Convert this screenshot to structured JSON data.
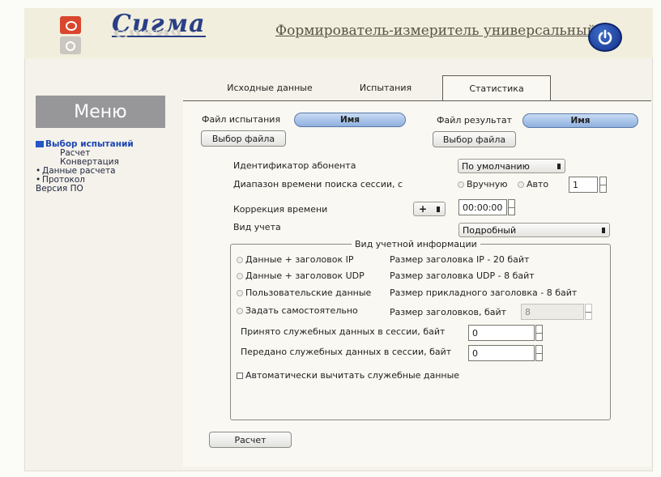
{
  "header": {
    "brand": "Сигма",
    "brand_reflection": "Сигма",
    "app_title": "Формирователь-измеритель универсальный"
  },
  "sidebar": {
    "title": "Меню",
    "items": [
      {
        "label": "Выбор испытаний",
        "level": 0,
        "active": true
      },
      {
        "label": "Расчет",
        "level": 1
      },
      {
        "label": "Конвертация",
        "level": 1
      },
      {
        "label": "Данные расчета",
        "level": 0,
        "bullet": "•"
      },
      {
        "label": "Протокол",
        "level": 0,
        "bullet": "•"
      },
      {
        "label": "Версия ПО",
        "level": 0
      }
    ]
  },
  "tabs": [
    {
      "label": "Исходные данные"
    },
    {
      "label": "Испытания"
    },
    {
      "label": "Статистика",
      "active": true
    }
  ],
  "files": {
    "test_label": "Файл испытания",
    "test_name": "Имя",
    "result_label": "Файл результат",
    "result_name": "Имя",
    "choose_button": "Выбор файла"
  },
  "form": {
    "subscriber_id_label": "Идентификатор абонента",
    "subscriber_id_value": "По умолчанию",
    "range_label": "Диапазон времени поиска сессии, с",
    "manual_label": "Вручную",
    "auto_label": "Авто",
    "range_value": "1",
    "correction_label": "Коррекция времени",
    "correction_sign": "+",
    "correction_value": "00:00:00",
    "accounting_label": "Вид учета",
    "accounting_value": "Подробный"
  },
  "group": {
    "title": "Вид учетной информации",
    "options": [
      {
        "label": "Данные + заголовок IP",
        "info": "Размер заголовка IP - 20 байт"
      },
      {
        "label": "Данные + заголовок UDP",
        "info": "Размер заголовка UDP - 8 байт"
      },
      {
        "label": "Пользовательские данные",
        "info": "Размер прикладного заголовка - 8 байт"
      },
      {
        "label": "Задать самостоятельно",
        "info": "Размер заголовков, байт"
      }
    ],
    "header_size_value": "8",
    "received_label": "Принято служебных данных в сессии, байт",
    "received_value": "0",
    "sent_label": "Передано служебных данных в сессии, байт",
    "sent_value": "0",
    "auto_subtract_label": "Автоматически вычитать служебные данные"
  },
  "actions": {
    "calculate": "Расчет"
  }
}
